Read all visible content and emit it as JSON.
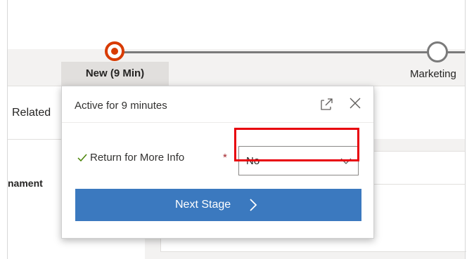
{
  "process": {
    "active_stage": {
      "label": "New  (9 Min)"
    },
    "next_stage": {
      "label": "Marketing"
    }
  },
  "left_panel": {
    "tab_label": "Related",
    "section_text": "nament"
  },
  "flyout": {
    "title": "Active for 9 minutes",
    "field": {
      "label": "Return for More Info",
      "required_marker": "*",
      "value": "No"
    },
    "next_button_label": "Next Stage"
  },
  "colors": {
    "active_stage": "#d83b01",
    "next_button": "#3b79bf",
    "highlight": "#e8000b",
    "check": "#498205"
  },
  "icons": [
    "stage-active-icon",
    "stage-inactive-icon",
    "expand-icon",
    "close-icon",
    "checkmark-icon",
    "chevron-down-icon",
    "chevron-right-icon"
  ]
}
